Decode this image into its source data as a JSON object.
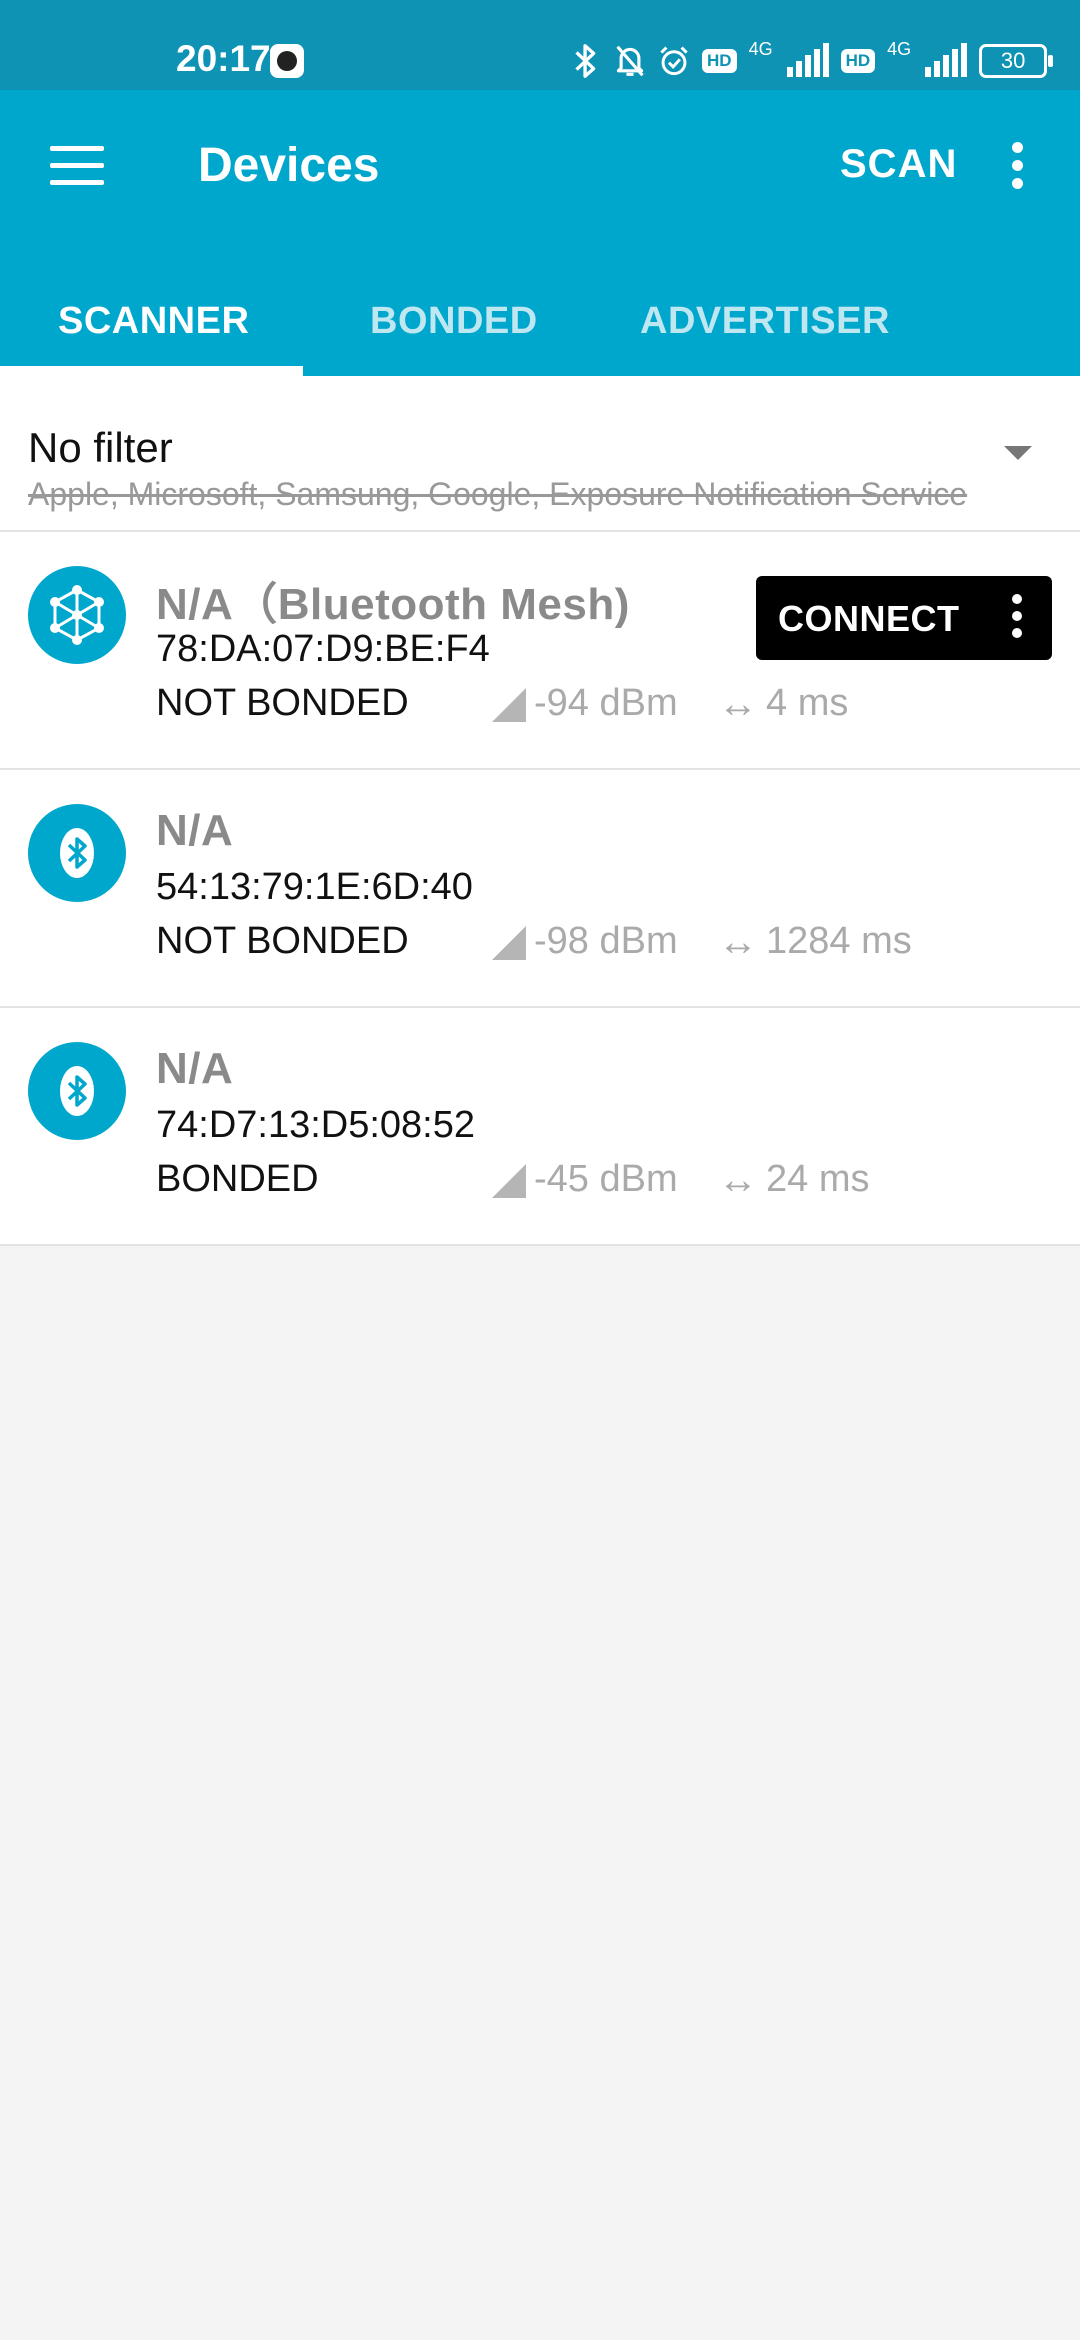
{
  "status_bar": {
    "time": "20:17",
    "network_label_1": "4G",
    "network_label_2": "4G",
    "hd_label_1": "HD",
    "hd_label_2": "HD",
    "battery": "30",
    "icons": [
      "bluetooth-icon",
      "mute-icon",
      "alarm-icon"
    ]
  },
  "app_bar": {
    "title": "Devices",
    "scan_label": "SCAN"
  },
  "tabs": [
    {
      "label": "SCANNER",
      "active": true
    },
    {
      "label": "BONDED",
      "active": false
    },
    {
      "label": "ADVERTISER",
      "active": false
    }
  ],
  "filter": {
    "label": "No filter",
    "excluded": "Apple, Microsoft, Samsung, Google, Exposure Notification Service"
  },
  "devices": [
    {
      "name": "N/A（Bluetooth Mesh)",
      "mac": "78:DA:07:D9:BE:F4",
      "bond": "NOT BONDED",
      "rssi": "-94 dBm",
      "interval": "4 ms",
      "icon": "mesh-icon",
      "connect_label": "CONNECT"
    },
    {
      "name": "N/A",
      "mac": "54:13:79:1E:6D:40",
      "bond": "NOT BONDED",
      "rssi": "-98 dBm",
      "interval": "1284 ms",
      "icon": "bluetooth-icon"
    },
    {
      "name": "N/A",
      "mac": "74:D7:13:D5:08:52",
      "bond": "BONDED",
      "rssi": "-45 dBm",
      "interval": "24 ms",
      "icon": "bluetooth-icon"
    }
  ],
  "colors": {
    "primary": "#00a7cc",
    "status_bar": "#0e93b5",
    "tab_inactive": "#bfe7f2",
    "connect_bg": "#000000"
  }
}
